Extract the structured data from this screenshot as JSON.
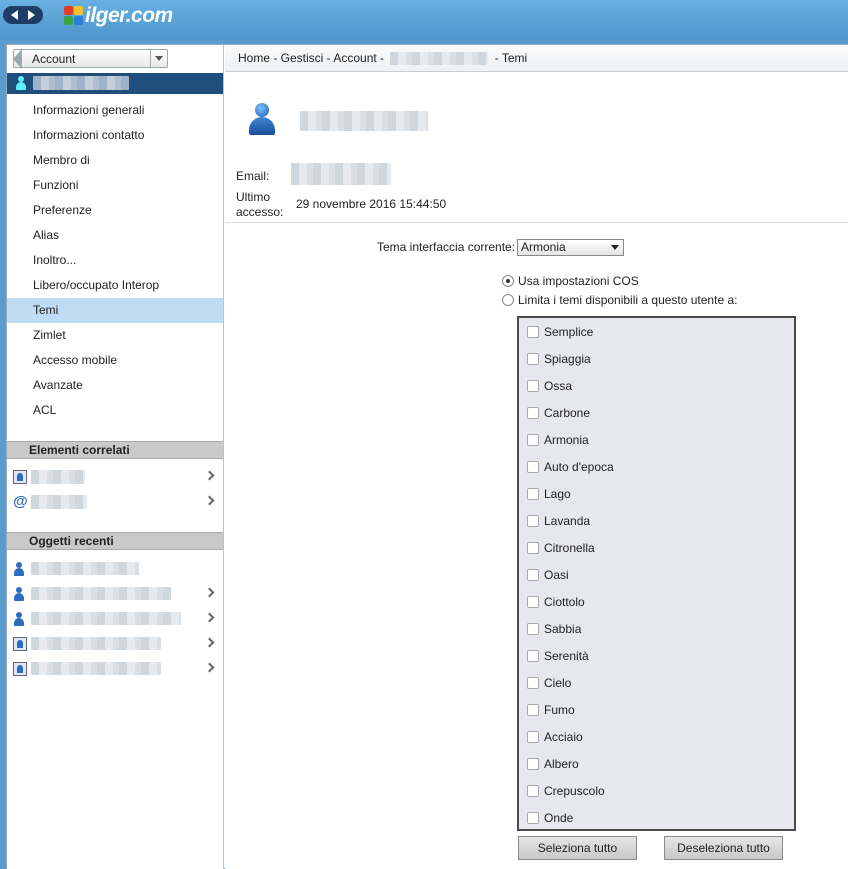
{
  "brand": {
    "logo_text": "ilger.com"
  },
  "sidebar": {
    "account_select": "Account",
    "menu": [
      "Informazioni generali",
      "Informazioni contatto",
      "Membro di",
      "Funzioni",
      "Preferenze",
      "Alias",
      "Inoltro...",
      "Libero/occupato Interop",
      "Temi",
      "Zimlet",
      "Accesso mobile",
      "Avanzate",
      "ACL"
    ],
    "selected_item": "Temi",
    "related_header": "Elementi correlati",
    "recent_header": "Oggetti recenti",
    "related_icons": [
      "resource-icon",
      "at-icon"
    ],
    "recent_icons": [
      "user-icon",
      "user-icon",
      "user-icon",
      "resource-icon",
      "resource-icon"
    ]
  },
  "breadcrumb": {
    "prefix": "Home - Gestisci - Account -",
    "suffix": "- Temi"
  },
  "info": {
    "email_label": "Email:",
    "last_access_label_1": "Ultimo",
    "last_access_label_2": "accesso:",
    "last_access_value": "29 novembre 2016 15:44:50"
  },
  "themes": {
    "current_label": "Tema interfaccia corrente:",
    "current_value": "Armonia",
    "radio_cos": "Usa impostazioni COS",
    "radio_limit": "Limita i temi disponibili a questo utente a:",
    "items": [
      "Semplice",
      "Spiaggia",
      "Ossa",
      "Carbone",
      "Armonia",
      "Auto d'epoca",
      "Lago",
      "Lavanda",
      "Citronella",
      "Oasi",
      "Ciottolo",
      "Sabbia",
      "Serenità",
      "Cielo",
      "Fumo",
      "Acciaio",
      "Albero",
      "Crepuscolo",
      "Onde"
    ],
    "select_all": "Seleziona tutto",
    "deselect_all": "Deseleziona tutto"
  },
  "colors": {
    "topbar": "#4d95cb",
    "account_header": "#1f4e7c",
    "selected_menu": "#bfdcf4",
    "theme_list_bg": "#e6e8ed"
  }
}
